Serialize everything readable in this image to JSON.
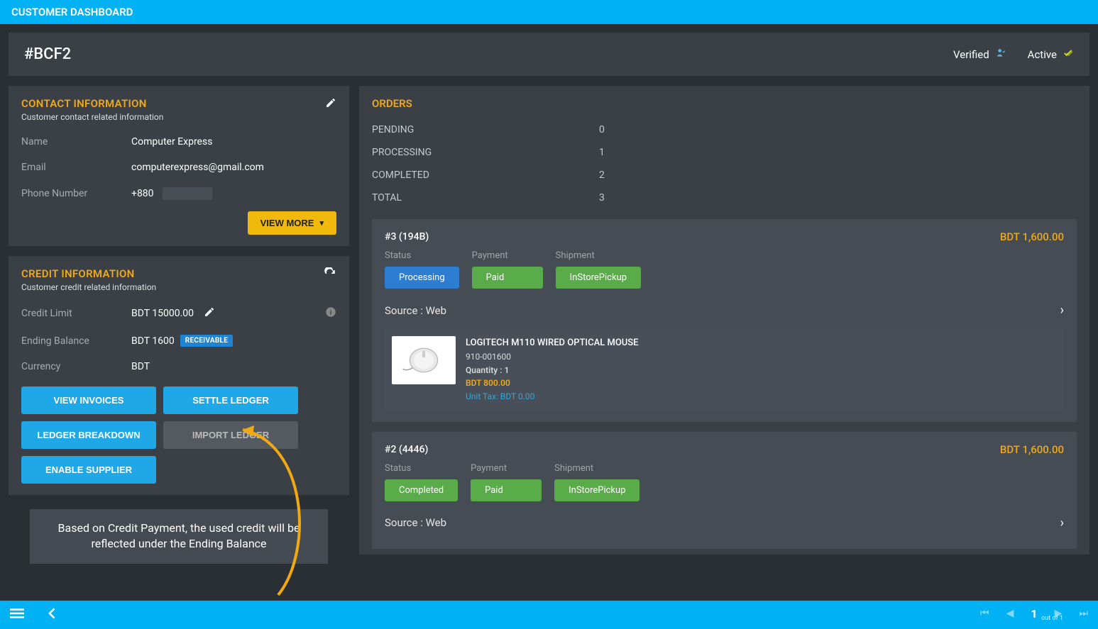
{
  "topbar": {
    "title": "CUSTOMER DASHBOARD"
  },
  "header": {
    "customer_id": "#BCF2",
    "status_verified": "Verified",
    "status_active": "Active"
  },
  "contact": {
    "title": "CONTACT INFORMATION",
    "subtitle": "Customer contact related information",
    "name_label": "Name",
    "name_value": "Computer Express",
    "email_label": "Email",
    "email_value": "computerexpress@gmail.com",
    "phone_label": "Phone Number",
    "phone_value": "+880",
    "view_more": "VIEW MORE"
  },
  "credit": {
    "title": "CREDIT INFORMATION",
    "subtitle": "Customer credit related information",
    "limit_label": "Credit Limit",
    "limit_value": "BDT 15000.00",
    "ending_label": "Ending Balance",
    "ending_value": "BDT 1600",
    "badge": "RECEIVABLE",
    "currency_label": "Currency",
    "currency_value": "BDT",
    "btn_view_invoices": "VIEW INVOICES",
    "btn_settle_ledger": "SETTLE LEDGER",
    "btn_ledger_breakdown": "LEDGER BREAKDOWN",
    "btn_import_ledger": "IMPORT LEDGER",
    "btn_enable_supplier": "ENABLE SUPPLIER"
  },
  "hint": {
    "text": "Based on Credit Payment, the used credit will be reflected under the Ending Balance"
  },
  "orders": {
    "title": "ORDERS",
    "pending_label": "PENDING",
    "pending_value": "0",
    "processing_label": "PROCESSING",
    "processing_value": "1",
    "completed_label": "COMPLETED",
    "completed_value": "2",
    "total_label": "TOTAL",
    "total_value": "3",
    "status_label": "Status",
    "payment_label": "Payment",
    "shipment_label": "Shipment",
    "source_prefix": "Source : ",
    "cards": [
      {
        "id": "#3 (194B)",
        "amount": "BDT 1,600.00",
        "status": "Processing",
        "status_color": "blue",
        "payment": "Paid",
        "shipment": "InStorePickup",
        "source": "Web",
        "product": {
          "name": "LOGITECH M110 WIRED OPTICAL MOUSE",
          "sku": "910-001600",
          "qty": "Quantity : 1",
          "price": "BDT 800.00",
          "tax": "Unit Tax: BDT 0.00"
        }
      },
      {
        "id": "#2 (4446)",
        "amount": "BDT 1,600.00",
        "status": "Completed",
        "status_color": "green",
        "payment": "Paid",
        "shipment": "InStorePickup",
        "source": "Web"
      }
    ]
  },
  "pager": {
    "current": "1",
    "total_text": "out of 1"
  }
}
